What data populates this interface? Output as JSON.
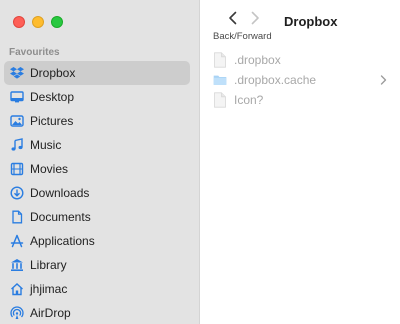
{
  "window": {
    "title": "Dropbox"
  },
  "toolbar": {
    "nav_label": "Back/Forward"
  },
  "sidebar": {
    "section_title": "Favourites",
    "items": [
      {
        "label": "Dropbox",
        "icon": "dropbox-icon",
        "selected": true
      },
      {
        "label": "Desktop",
        "icon": "desktop-icon"
      },
      {
        "label": "Pictures",
        "icon": "pictures-icon"
      },
      {
        "label": "Music",
        "icon": "music-icon"
      },
      {
        "label": "Movies",
        "icon": "movies-icon"
      },
      {
        "label": "Downloads",
        "icon": "downloads-icon"
      },
      {
        "label": "Documents",
        "icon": "documents-icon"
      },
      {
        "label": "Applications",
        "icon": "applications-icon"
      },
      {
        "label": "Library",
        "icon": "library-icon"
      },
      {
        "label": "jhjimac",
        "icon": "home-icon"
      },
      {
        "label": "AirDrop",
        "icon": "airdrop-icon"
      }
    ]
  },
  "files": [
    {
      "name": ".dropbox",
      "icon": "file-icon"
    },
    {
      "name": ".dropbox.cache",
      "icon": "folder-icon",
      "has_children": true
    },
    {
      "name": "Icon?",
      "icon": "file-icon"
    }
  ],
  "colors": {
    "sidebar_bg": "#e3e3e3",
    "selection": "#cdcdcd",
    "accent": "#2a7de1",
    "dim_text": "#a8a8a8"
  }
}
